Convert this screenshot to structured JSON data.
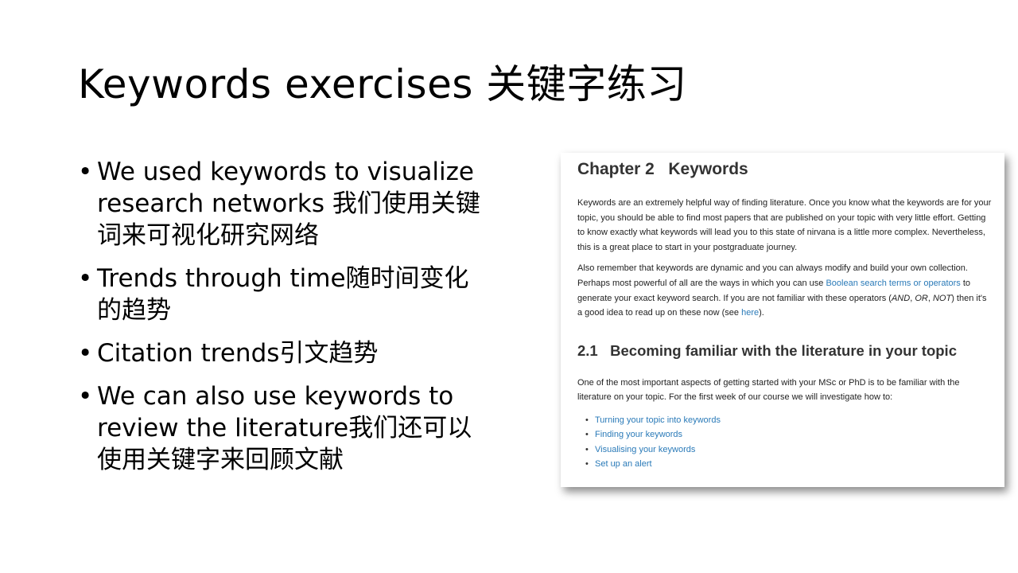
{
  "slide": {
    "title": "Keywords exercises    关键字练习",
    "bullet_char": "•",
    "bullets": [
      "We used keywords to visualize research networks  我们使用关键词来可视化研究网络",
      "Trends through time随时间变化的趋势",
      "Citation trends引文趋势",
      "We can also use keywords to review the literature我们还可以使用关键字来回顾文献"
    ]
  },
  "screenshot": {
    "chapter_title": "Chapter 2   Keywords",
    "para1": "Keywords are an extremely helpful way of finding literature. Once you know what the keywords are for your topic, you should be able to find most papers that are published on your topic with very little effort. Getting to know exactly what keywords will lead you to this state of nirvana is a little more complex. Nevertheless, this is a great place to start in your postgraduate journey.",
    "para2": {
      "part1": "Also remember that keywords are dynamic and you can always modify and build your own collection. Perhaps most powerful of all are the ways in which you can use ",
      "link1": "Boolean search terms or operators",
      "part2": " to generate your exact keyword search. If you are not familiar with these operators (",
      "op_and": "AND",
      "sep1": ", ",
      "op_or": "OR",
      "sep2": ", ",
      "op_not": "NOT",
      "part3": ") then it's a good idea to read up on these now (see ",
      "link2": "here",
      "part4": ")."
    },
    "section_title": "2.1   Becoming familiar with the literature in your topic",
    "para3": "One of the most important aspects of getting started with your MSc or PhD is to be familiar with the literature on your topic. For the first week of our course we will investigate how to:",
    "list_dot": "•",
    "links": [
      "Turning your topic into keywords",
      "Finding your keywords",
      "Visualising your keywords",
      "Set up an alert"
    ]
  },
  "colors": {
    "link": "#2a7ab8",
    "heading": "#333333",
    "text": "#222222",
    "background": "#ffffff"
  }
}
